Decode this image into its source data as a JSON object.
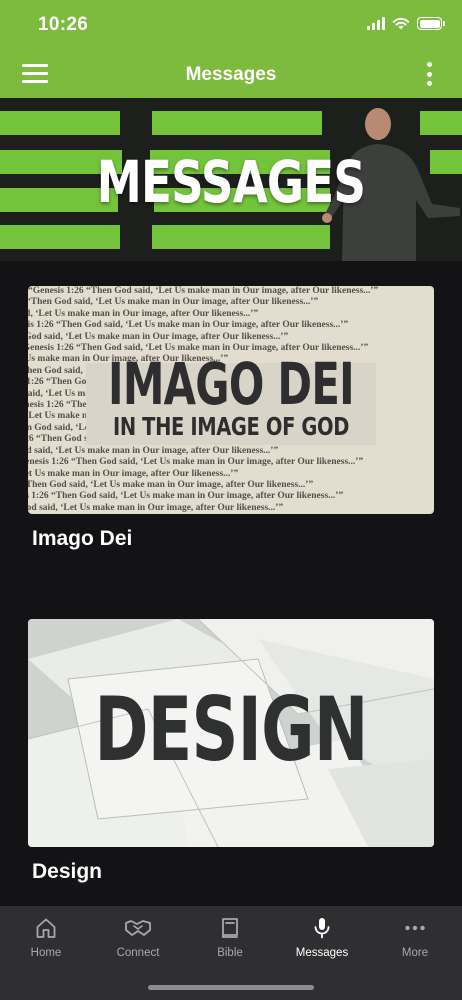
{
  "status_bar": {
    "time": "10:26"
  },
  "app_bar": {
    "title": "Messages"
  },
  "hero": {
    "title": "MESSAGES"
  },
  "messages": [
    {
      "title": "Imago Dei",
      "art_title": "IMAGO DEI",
      "art_subtitle": "IN THE IMAGE OF GOD",
      "art_background_text": "“Genesis 1:26 “Then God said, ‘Let Us make man in Our image, after Our likeness...’”"
    },
    {
      "title": "Design",
      "art_title": "DESIGN"
    }
  ],
  "tabs": [
    {
      "label": "Home",
      "icon": "home-icon",
      "active": false
    },
    {
      "label": "Connect",
      "icon": "handshake-icon",
      "active": false
    },
    {
      "label": "Bible",
      "icon": "book-icon",
      "active": false
    },
    {
      "label": "Messages",
      "icon": "microphone-icon",
      "active": true
    },
    {
      "label": "More",
      "icon": "ellipsis-icon",
      "active": false
    }
  ],
  "colors": {
    "brand_green": "#7dbb3f",
    "background": "#131315",
    "tab_bar": "#2f2f31"
  }
}
